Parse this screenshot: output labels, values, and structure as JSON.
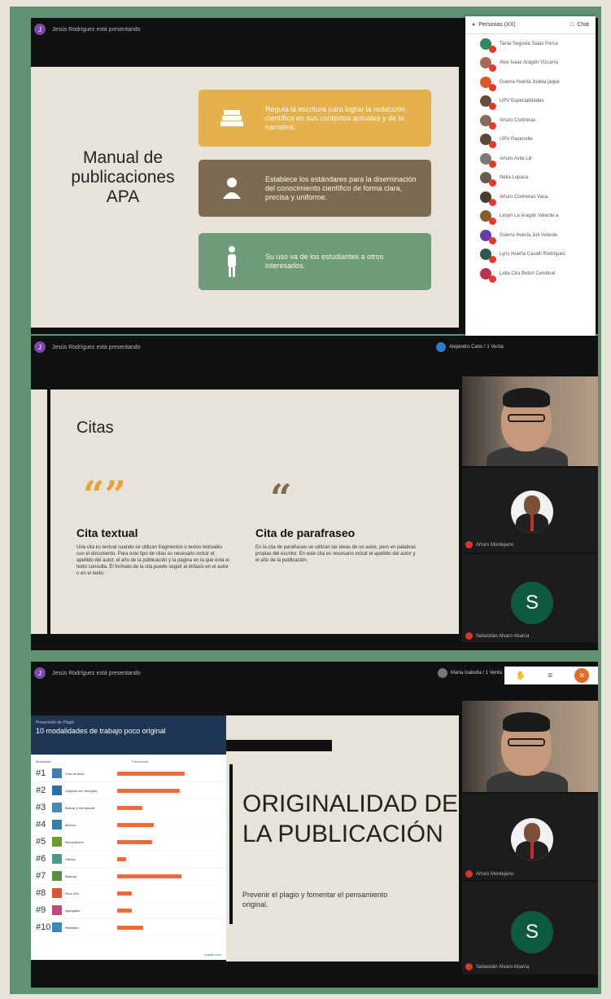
{
  "presenter_text": "Jesús Rodríguez está presentando",
  "slide1": {
    "title": "Manual de publicaciones APA",
    "cards": [
      {
        "icon": "books-icon",
        "text": "Regula la escritura para lograr la redacción científica en sus contextos actuales y de la narrativa.",
        "color": "#e5b14d"
      },
      {
        "icon": "person-icon",
        "text": "Establece los estándares para la diseminación del conocimiento científico de forma clara, precisa y uniforme.",
        "color": "#7d6b51"
      },
      {
        "icon": "figure-icon",
        "text": "Su uso va de los estudiantes a otros interesados.",
        "color": "#6e9c7a"
      }
    ]
  },
  "participants": {
    "tab_label": "Personas (XX)",
    "chat_label": "Chat",
    "list": [
      "Tania Segovia Salas Porca",
      "Alex Isaac Aragón Vizcarra",
      "Guerra Huerta Julieta jaque",
      "UPV Especialidades",
      "Arturo Contreras",
      "UPV Pastorelle",
      "Arturo Avila Lili",
      "Nelia Lupaca",
      "Arturo Contreras Vaca",
      "Leoyn La Aragón Velarde a",
      "Guerra Huerta Juli Velarde",
      "Lyris Huerta Cavalli Rodríguez",
      "Lidia Cira Betún Cendinal"
    ]
  },
  "slide2": {
    "title": "Citas",
    "quote_glyph_1": "“”",
    "quote_glyph_2": "“",
    "col1_title": "Cita textual",
    "col1_text": "Una cita es textual cuando se utilizan fragmentos o textos textuales con el documento. Para este tipo de citas es necesario incluir el apellido del autor, el año de la publicación y la página en la que está el texto consulta. El formato de la cita puede seguir al énfasis en el autor o en el texto.",
    "col2_title": "Cita de parafraseo",
    "col2_text": "En la cita de parafraseo se utilizan las ideas de un autor, pero en palabras propias del escritor. En este cita es necesario incluir el apellido del autor y el año de la publicación.",
    "raise_label": "Alejandro Cano / 1 Venta"
  },
  "video_tiles": {
    "tile1_label": "Arturo Montejano",
    "tile2_label": "Sebastián Alvaro Abarca",
    "s_initial": "S"
  },
  "slide3": {
    "title": "ORIGINALIDAD DE LA PUBLICACIÓN",
    "subtitle": "Prevenir el plagio y fomentar el pensamiento original.",
    "raise_label": "María Isabella / 1 Venta",
    "infographic": {
      "small": "Prevención de Plagio",
      "title": "10 modalidades de trabajo poco original",
      "col_left": "Modalidad",
      "col_right": "Frecuencia",
      "rows": [
        {
          "num": "#1",
          "label": "Clon de texto",
          "pct": 0.92,
          "color": "#3f7fb3"
        },
        {
          "num": "#2",
          "label": "Copiado con retoques",
          "pct": 0.86,
          "color": "#2f6ea2"
        },
        {
          "num": "#3",
          "label": "Buscar y reemplazar",
          "pct": 0.35,
          "color": "#4a8ab0"
        },
        {
          "num": "#4",
          "label": "Mezcla",
          "pct": 0.5,
          "color": "#3a7ea6"
        },
        {
          "num": "#5",
          "label": "Recopilación",
          "pct": 0.48,
          "color": "#6a9a34"
        },
        {
          "num": "#6",
          "label": "Híbrido",
          "pct": 0.12,
          "color": "#4b9a8a"
        },
        {
          "num": "#7",
          "label": "Mashup",
          "pct": 0.88,
          "color": "#5b8f3f"
        },
        {
          "num": "#8",
          "label": "Error 404",
          "pct": 0.2,
          "color": "#e0542f"
        },
        {
          "num": "#9",
          "label": "Agregador",
          "pct": 0.2,
          "color": "#c1487b"
        },
        {
          "num": "#10",
          "label": "Retwitteo",
          "pct": 0.36,
          "color": "#3c86c0"
        }
      ],
      "foot": "turnitin.com"
    }
  }
}
